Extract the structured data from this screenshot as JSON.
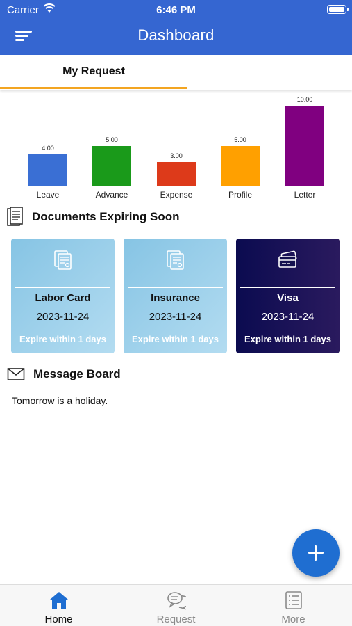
{
  "status_bar": {
    "carrier": "Carrier",
    "time": "6:46 PM"
  },
  "header": {
    "title": "Dashboard"
  },
  "tabs": [
    {
      "label": "My Request",
      "active": true
    }
  ],
  "chart_data": {
    "type": "bar",
    "categories": [
      "Leave",
      "Advance",
      "Expense",
      "Profile",
      "Letter"
    ],
    "values": [
      4,
      5,
      3,
      5,
      10
    ],
    "value_labels": [
      "4.00",
      "5.00",
      "3.00",
      "5.00",
      "10.00"
    ],
    "colors": [
      "#3a6fd4",
      "#1a9a1a",
      "#dd3a1a",
      "#ffa000",
      "#800080"
    ],
    "ylim": [
      0,
      10
    ]
  },
  "documents": {
    "title": "Documents Expiring Soon",
    "cards": [
      {
        "name": "Labor Card",
        "date": "2023-11-24",
        "expiry": "Expire within 1 days",
        "icon": "document-icon"
      },
      {
        "name": "Insurance",
        "date": "2023-11-24",
        "expiry": "Expire within 1 days",
        "icon": "document-icon"
      },
      {
        "name": "Visa",
        "date": "2023-11-24",
        "expiry": "Expire within 1 days",
        "icon": "credit-card-icon"
      }
    ]
  },
  "message_board": {
    "title": "Message Board",
    "message": "Tomorrow is a holiday."
  },
  "bottom_nav": [
    {
      "label": "Home",
      "active": true
    },
    {
      "label": "Request",
      "active": false
    },
    {
      "label": "More",
      "active": false
    }
  ],
  "colors": {
    "primary": "#3566d1",
    "tab_indicator": "#f3a521",
    "fab": "#1f6ed1",
    "nav_active": "#1f6ed1",
    "nav_inactive": "#8a8a8a"
  }
}
